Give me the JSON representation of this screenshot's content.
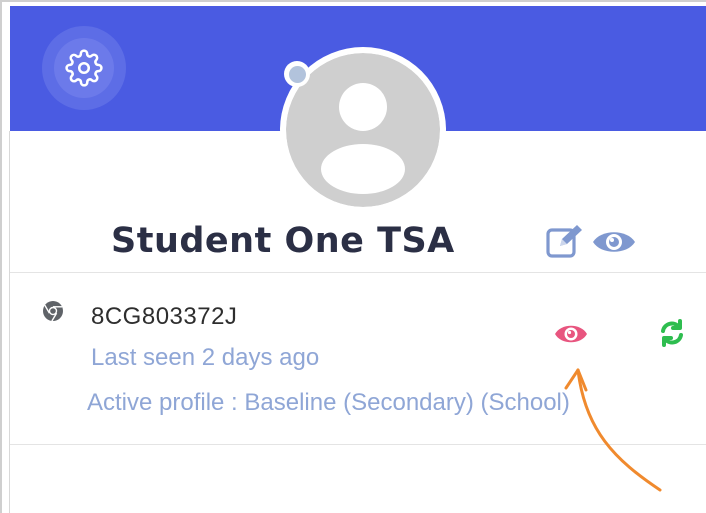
{
  "profile": {
    "name": "Student One TSA"
  },
  "icons": {
    "settings": "gear-icon",
    "edit": "edit-icon",
    "view": "eye-icon",
    "browser": "chrome-icon",
    "device_view": "eye-icon",
    "sync": "sync-icon",
    "annotation": "arrow-icon"
  },
  "device": {
    "name": "8CG803372J",
    "last_seen": "Last seen 2 days ago",
    "active_profile": "Active profile : Baseline (Secondary) (School)"
  },
  "colors": {
    "header": "#4a5be2",
    "name_text": "#2b2f45",
    "secondary_text": "#8fa6d6",
    "view_eye": "#e8557f",
    "sync": "#2ebd4f",
    "annotation_arrow": "#f08a2e"
  }
}
